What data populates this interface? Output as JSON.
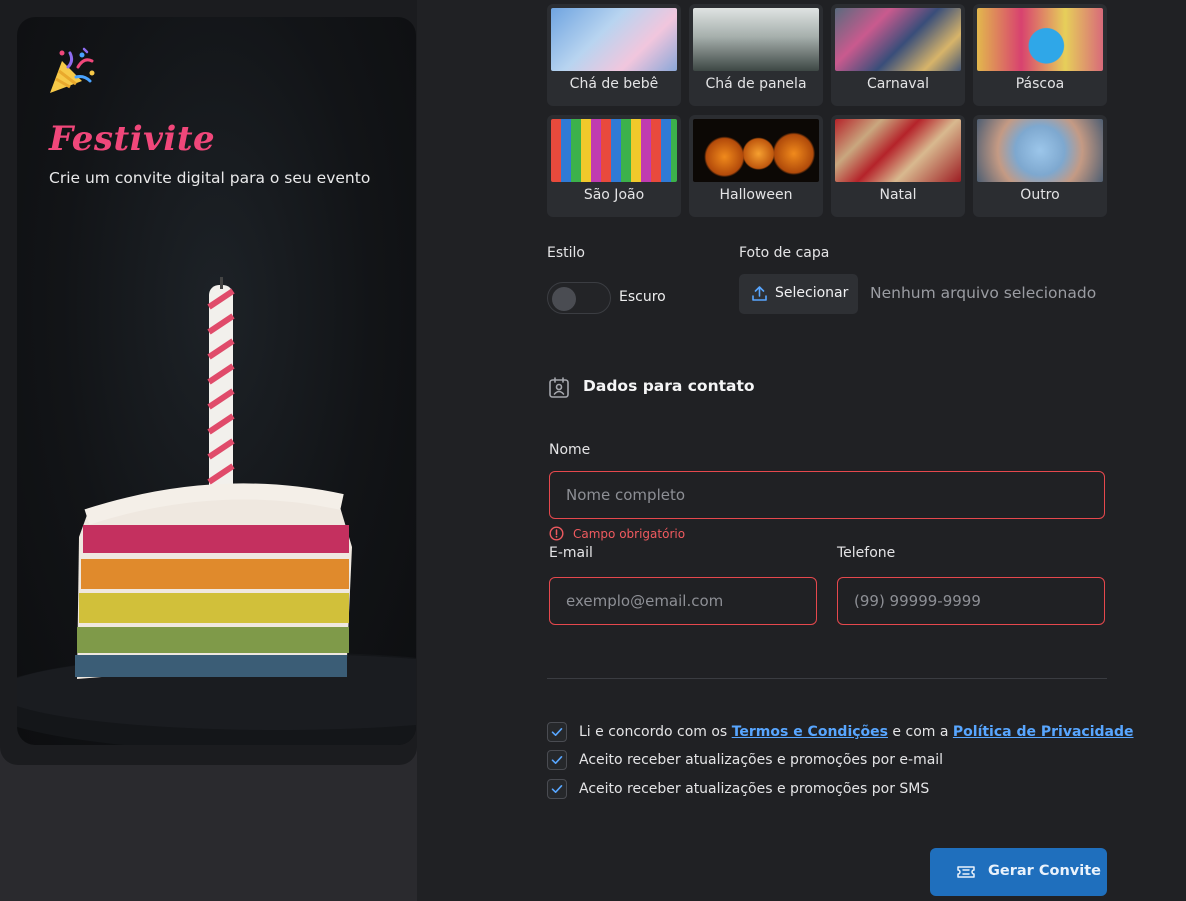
{
  "brand": {
    "name": "Festivite",
    "tagline": "Crie um convite digital para o seu evento",
    "logo_icon": "party-popper-icon"
  },
  "categories": [
    {
      "label": "Chá de bebê",
      "image": "baby-shower-photo"
    },
    {
      "label": "Chá de panela",
      "image": "kitchen-shower-photo"
    },
    {
      "label": "Carnaval",
      "image": "carnival-photo"
    },
    {
      "label": "Páscoa",
      "image": "easter-photo"
    },
    {
      "label": "São João",
      "image": "festa-junina-photo"
    },
    {
      "label": "Halloween",
      "image": "halloween-photo"
    },
    {
      "label": "Natal",
      "image": "christmas-photo"
    },
    {
      "label": "Outro",
      "image": "celebration-photo"
    }
  ],
  "style": {
    "label": "Estilo",
    "toggle_label": "Escuro",
    "toggle_on": false
  },
  "cover": {
    "label": "Foto de capa",
    "button_label": "Selecionar",
    "status": "Nenhum arquivo selecionado"
  },
  "contact": {
    "title": "Dados para contato",
    "name": {
      "label": "Nome",
      "placeholder": "Nome completo",
      "value": "",
      "error": "Campo obrigatório"
    },
    "email": {
      "label": "E-mail",
      "placeholder": "exemplo@email.com",
      "value": ""
    },
    "phone": {
      "label": "Telefone",
      "placeholder": "(99) 99999-9999",
      "value": ""
    }
  },
  "consents": [
    {
      "pre": "Li e concordo com os ",
      "link1": "Termos e Condições",
      "mid": " e com a ",
      "link2": "Política de Privacidade",
      "checked": true
    },
    {
      "text": "Aceito receber atualizações e promoções por e-mail",
      "checked": true
    },
    {
      "text": "Aceito receber atualizações e promoções por SMS",
      "checked": true
    }
  ],
  "submit": {
    "label": "Gerar Convite",
    "icon": "ticket-icon"
  },
  "colors": {
    "brand": "#f0477a",
    "error": "#e5484d",
    "link": "#58a6ff",
    "primary": "#1f6fbd"
  }
}
